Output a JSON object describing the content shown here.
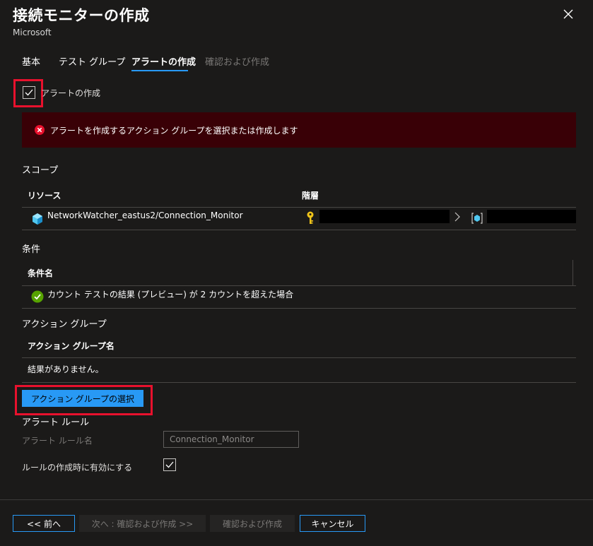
{
  "header": {
    "title": "接続モニターの作成",
    "subtitle": "Microsoft"
  },
  "tabs": [
    {
      "label": "基本",
      "state": "normal"
    },
    {
      "label": "テスト グループ",
      "state": "normal"
    },
    {
      "label": "アラートの作成",
      "state": "active"
    },
    {
      "label": "確認および作成",
      "state": "disabled"
    }
  ],
  "alert_checkbox": {
    "label": "アラートの作成",
    "checked": true
  },
  "error": {
    "message": "アラートを作成するアクション グループを選択または作成します"
  },
  "scope": {
    "title": "スコープ",
    "columns": {
      "resource": "リソース",
      "hierarchy": "階層"
    },
    "row": {
      "resource": "NetworkWatcher_eastus2/Connection_Monitor"
    }
  },
  "condition": {
    "title": "条件",
    "column": "条件名",
    "row": "カウント テストの結果 (プレビュー) が 2 カウントを超えた場合"
  },
  "action_group": {
    "title": "アクション グループ",
    "column": "アクション グループ名",
    "empty": "結果がありません。",
    "select_button": "アクション グループの選択"
  },
  "alert_rule": {
    "title": "アラート ルール",
    "name_label": "アラート ルール名",
    "name_value": "Connection_Monitor",
    "enable_label": "ルールの作成時に有効にする",
    "enable_checked": true
  },
  "footer": {
    "prev": "<< 前へ",
    "next": "次へ : 確認および作成 >>",
    "review": "確認および作成",
    "cancel": "キャンセル"
  },
  "colors": {
    "accent": "#2899f5",
    "error_bg": "#390006",
    "highlight": "#e8112d"
  }
}
